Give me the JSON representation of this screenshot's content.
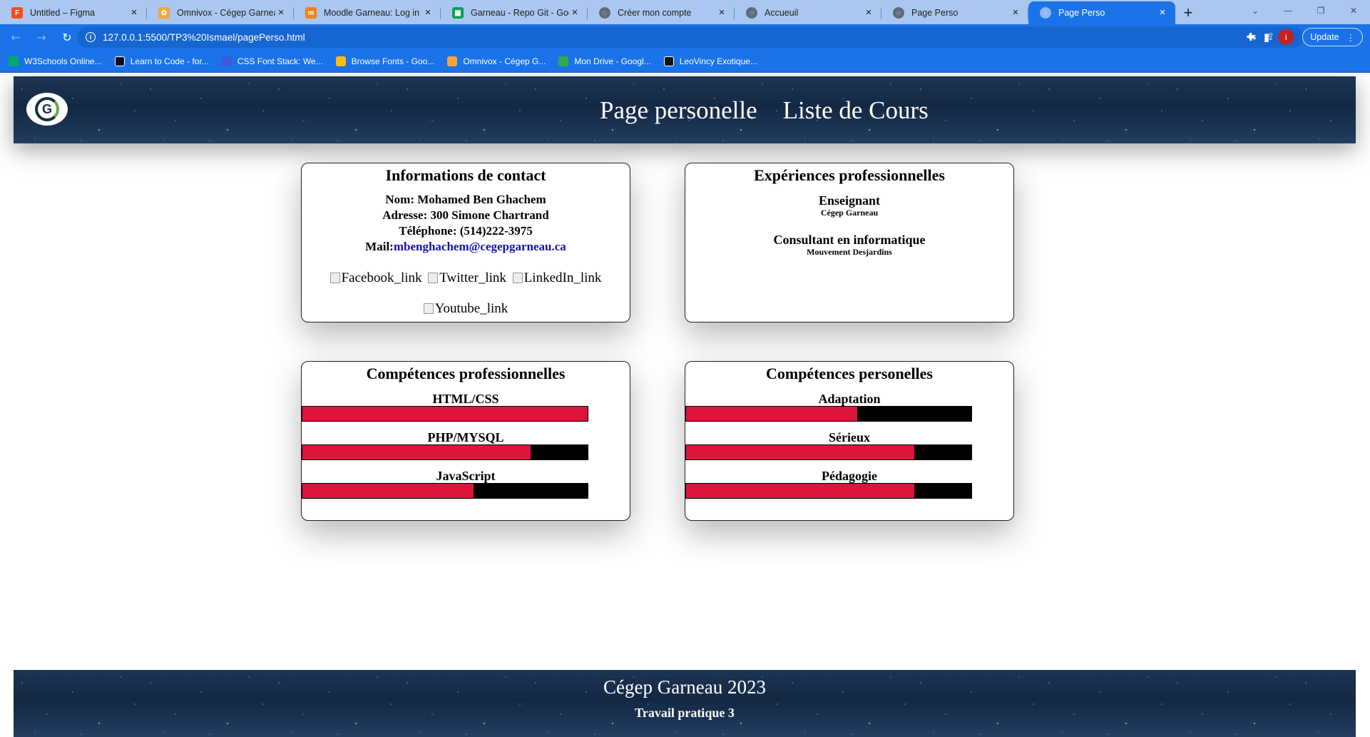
{
  "browser": {
    "tabs": [
      {
        "title": "Untitled – Figma",
        "icon": "figma-icon",
        "color": "#f24e1e",
        "active": false
      },
      {
        "title": "Omnivox - Cégep Garneau",
        "icon": "omnivox-icon",
        "color": "#f4a53a",
        "active": false
      },
      {
        "title": "Moodle Garneau: Log in to",
        "icon": "moodle-icon",
        "color": "#f98012",
        "active": false
      },
      {
        "title": "Garneau - Repo Git - Goog",
        "icon": "sheets-icon",
        "color": "#0f9d58",
        "active": false
      },
      {
        "title": "Créer mon compte",
        "icon": "globe-icon",
        "color": "#5f6b7a",
        "active": false
      },
      {
        "title": "Accueuil",
        "icon": "globe-icon",
        "color": "#5f6b7a",
        "active": false
      },
      {
        "title": "Page Perso",
        "icon": "globe-icon",
        "color": "#5f6b7a",
        "active": false
      },
      {
        "title": "Page Perso",
        "icon": "globe-icon",
        "color": "#5f6b7a",
        "active": true
      }
    ],
    "url": "127.0.0.1:5500/TP3%20Ismael/pagePerso.html",
    "update_label": "Update",
    "profile_initial": "i",
    "bookmarks": [
      {
        "label": "W3Schools Online...",
        "icon": "w3schools-icon",
        "color": "#04aa6d"
      },
      {
        "label": "Learn to Code - for...",
        "icon": "freecodecamp-icon",
        "color": "#0a0a23"
      },
      {
        "label": "CSS Font Stack: We...",
        "icon": "cssfontstack-icon",
        "color": "#3b5bdb"
      },
      {
        "label": "Browse Fonts - Goo...",
        "icon": "googlefonts-icon",
        "color": "#fbbc04"
      },
      {
        "label": "Omnivox - Cégep G...",
        "icon": "omnivox-icon",
        "color": "#f4a53a"
      },
      {
        "label": "Mon Drive - Googl...",
        "icon": "drive-icon",
        "color": "#34a853"
      },
      {
        "label": "LeoVincy Exotique...",
        "icon": "leovincy-icon",
        "color": "#111111"
      }
    ]
  },
  "header": {
    "nav": [
      "Page personelle",
      "Liste de Cours"
    ]
  },
  "contact": {
    "title": "Informations de contact",
    "name": "Nom: Mohamed Ben Ghachem",
    "address": "Adresse: 300 Simone Chartrand",
    "phone": "Téléphone: (514)222-3975",
    "mail_label": "Mail:",
    "mail": "mbenghachem@cegepgarneau.ca",
    "socials": [
      "Facebook_link",
      "Twitter_link",
      "LinkedIn_link",
      "Youtube_link"
    ]
  },
  "experience": {
    "title": "Expériences professionnelles",
    "items": [
      {
        "role": "Enseignant",
        "org": "Cégep Garneau"
      },
      {
        "role": "Consultant en informatique",
        "org": "Mouvement Desjardins"
      }
    ]
  },
  "pro_skills": {
    "title": "Compétences professionnelles",
    "items": [
      {
        "name": "HTML/CSS",
        "level": 1.0
      },
      {
        "name": "PHP/MYSQL",
        "level": 0.8
      },
      {
        "name": "JavaScript",
        "level": 0.6
      }
    ]
  },
  "perso_skills": {
    "title": "Compétences personelles",
    "items": [
      {
        "name": "Adaptation",
        "level": 0.6
      },
      {
        "name": "Sérieux",
        "level": 0.8
      },
      {
        "name": "Pédagogie",
        "level": 0.8
      }
    ]
  },
  "footer": {
    "title": "Cégep Garneau 2023",
    "subtitle": "Travail pratique 3"
  },
  "colors": {
    "accent": "#1a73e8",
    "bar_fill": "#dc143c",
    "bar_track": "#000000"
  }
}
